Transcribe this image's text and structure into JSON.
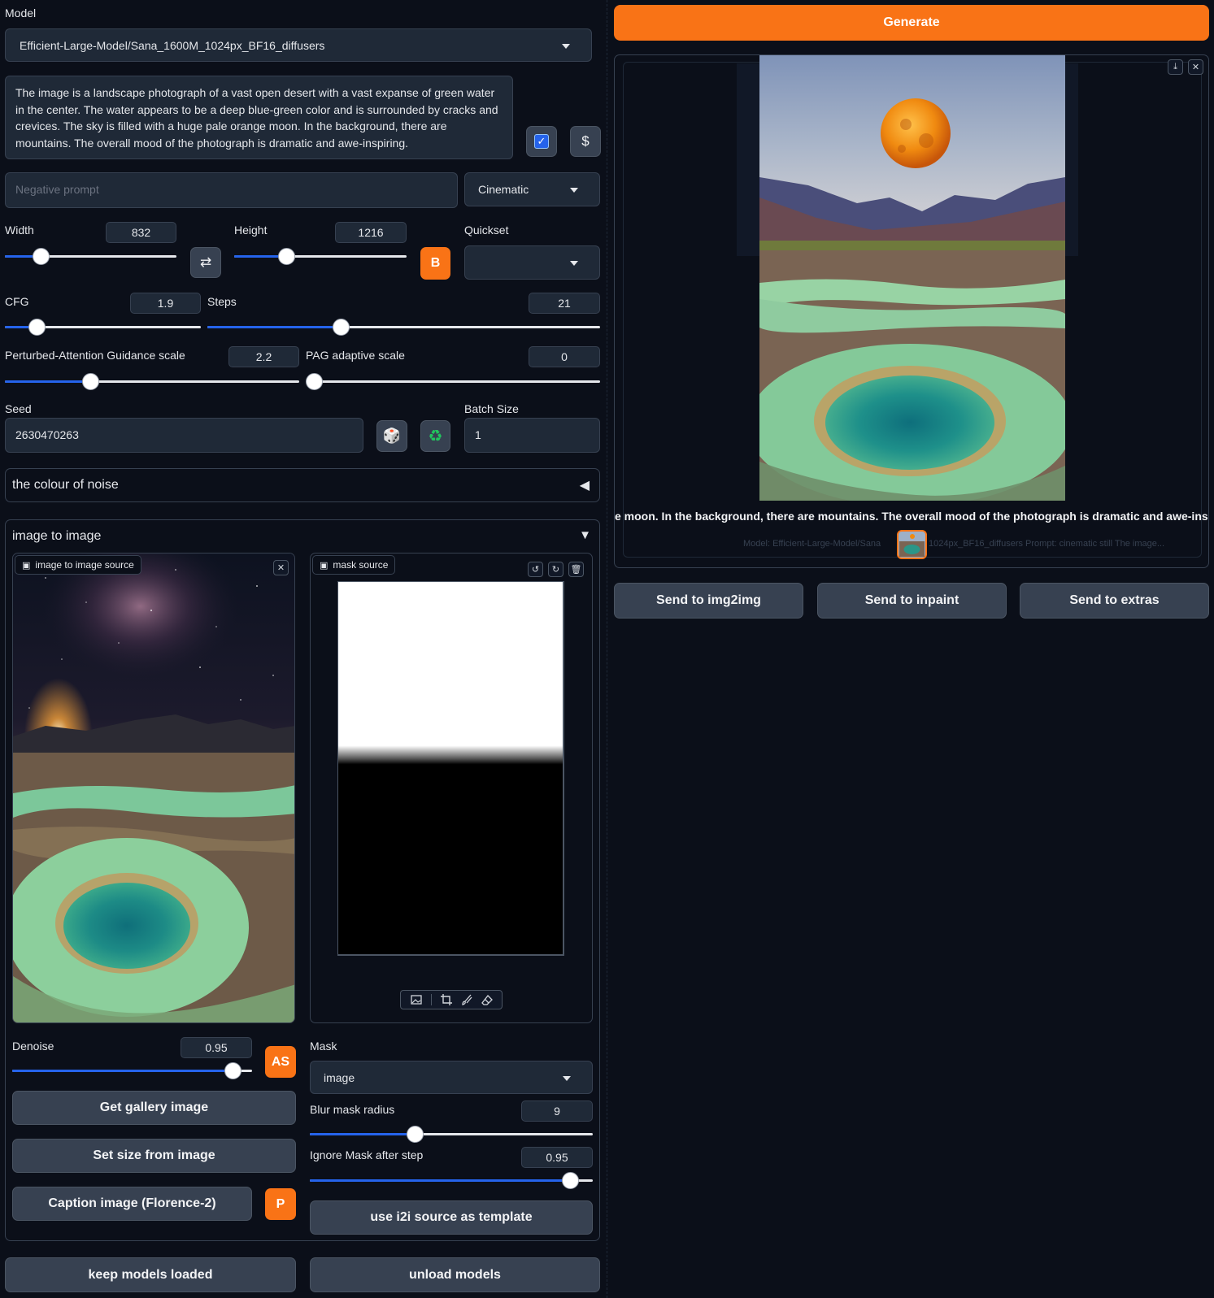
{
  "model": {
    "label": "Model",
    "value": "Efficient-Large-Model/Sana_1600M_1024px_BF16_diffusers"
  },
  "prompt": {
    "text": "The image is a landscape photograph of a vast open desert with a vast expanse of green water in the center. The water appears to be a deep blue-green color and is surrounded by cracks and crevices. The sky is filled with a huge pale orange moon. In the background, there are mountains. The overall mood of the photograph is dramatic and awe-inspiring."
  },
  "prompt_buttons": {
    "check_label": "✓",
    "dollar_label": "$"
  },
  "negative_prompt": {
    "placeholder": "Negative prompt",
    "value": ""
  },
  "style": {
    "value": "Cinematic"
  },
  "width": {
    "label": "Width",
    "value": "832",
    "level": 0.21
  },
  "height": {
    "label": "Height",
    "value": "1216",
    "level": 0.3
  },
  "swap_button": {
    "label": "⇄"
  },
  "b_button": {
    "label": "B"
  },
  "quickset": {
    "label": "Quickset",
    "value": ""
  },
  "cfg": {
    "label": "CFG",
    "value": "1.9",
    "level": 0.16
  },
  "steps": {
    "label": "Steps",
    "value": "21",
    "level": 0.34
  },
  "pag": {
    "label": "Perturbed-Attention Guidance scale",
    "value": "2.2",
    "level": 0.29
  },
  "pag_adaptive": {
    "label": "PAG adaptive scale",
    "value": "0",
    "level": 0.0
  },
  "seed": {
    "label": "Seed",
    "value": "2630470263",
    "dice_label": "🎲",
    "recycle_label": "♻"
  },
  "batch": {
    "label": "Batch Size",
    "value": "1"
  },
  "accordion_noise": {
    "title": "the colour of noise",
    "arrow": "◀"
  },
  "accordion_i2i": {
    "title": "image to image",
    "arrow": "▼"
  },
  "i2i_source": {
    "label": "image to image source",
    "close_label": "✕"
  },
  "mask_source": {
    "label": "mask source",
    "undo_label": "↺",
    "redo_label": "↻",
    "delete_label": "🗑",
    "tools": [
      "image-tool",
      "crop-tool",
      "brush-tool",
      "eraser-tool"
    ]
  },
  "denoise": {
    "label": "Denoise",
    "value": "0.95",
    "level": 0.92
  },
  "as_button": {
    "label": "AS"
  },
  "mask": {
    "label": "Mask",
    "value": "image"
  },
  "blur": {
    "label": "Blur mask radius",
    "value": "9",
    "level": 0.37
  },
  "ignore": {
    "label": "Ignore Mask after step",
    "value": "0.95",
    "level": 0.92
  },
  "buttons": {
    "get_gallery": "Get gallery image",
    "set_size": "Set size from image",
    "caption": "Caption image (Florence-2)",
    "p_label": "P",
    "use_template": "use i2i source as template",
    "keep_models": "keep models loaded",
    "unload_models": "unload models"
  },
  "generate": {
    "label": "Generate"
  },
  "gallery": {
    "caption": "e moon. In the background, there are mountains. The overall mood of the photograph is dramatic and awe-inspiring.",
    "meta_left": "Model: Efficient-Large-Model/Sana",
    "meta_right": "1024px_BF16_diffusers Prompt: cinematic still The image...",
    "download_label": "⤓",
    "close_label": "✕"
  },
  "send": {
    "img2img": "Send to img2img",
    "inpaint": "Send to inpaint",
    "extras": "Send to extras"
  },
  "colors": {
    "background": "#0b0f19",
    "panel": "#1f2937",
    "border": "#374151",
    "accent_orange": "#f97316",
    "slider_blue": "#2563eb"
  }
}
